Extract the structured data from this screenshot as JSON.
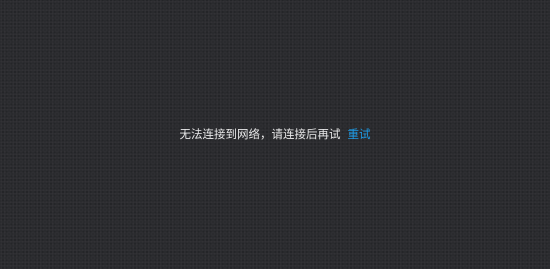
{
  "network_error": {
    "message": "无法连接到网络，请连接后再试",
    "retry_label": "重试",
    "retry_color": "#1e9be6"
  }
}
